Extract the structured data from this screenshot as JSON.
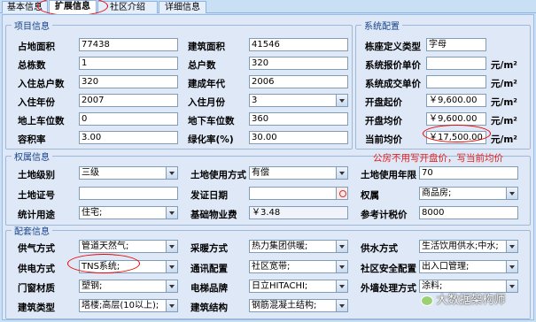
{
  "tabs": [
    "基本信息",
    "扩展信息",
    "社区介绍",
    "详细信息"
  ],
  "project": {
    "legend": "项目信息",
    "rows": [
      {
        "l1": "占地面积",
        "v1": "77438",
        "l2": "建筑面积",
        "v2": "41546"
      },
      {
        "l1": "总栋数",
        "v1": "1",
        "l2": "总户数",
        "v2": "320"
      },
      {
        "l1": "入住总户数",
        "v1": "320",
        "l2": "建成年代",
        "v2": "2006"
      },
      {
        "l1": "入住年份",
        "v1": "2007",
        "l2": "入住月份",
        "v2": "3"
      },
      {
        "l1": "地上车位数",
        "v1": "0",
        "l2": "地下车位数",
        "v2": "360"
      },
      {
        "l1": "容积率",
        "v1": "3.00",
        "l2": "绿化率(%)",
        "v2": "30.00"
      }
    ]
  },
  "system": {
    "legend": "系统配置",
    "rows": [
      {
        "label": "栋座定义类型",
        "value": "字母",
        "unit": ""
      },
      {
        "label": "系统报价单价",
        "value": "",
        "unit": "元/m²"
      },
      {
        "label": "系统成交单价",
        "value": "",
        "unit": "元/m²"
      },
      {
        "label": "开盘起价",
        "value": "￥9,600.00",
        "unit": "元/m²"
      },
      {
        "label": "开盘均价",
        "value": "￥9,600.00",
        "unit": "元/m²"
      },
      {
        "label": "当前均价",
        "value": "￥17,500.00",
        "unit": "元/m²"
      }
    ]
  },
  "note": "公房不用写开盘价，写当前均价",
  "rights": {
    "legend": "权属信息",
    "land_level_label": "土地级别",
    "land_level": "三级",
    "land_usage_label": "土地使用方式",
    "land_usage": "有偿",
    "land_years_label": "土地使用年限",
    "land_years": "70",
    "land_cert_label": "土地证号",
    "land_cert": "",
    "issue_date_label": "发证日期",
    "issue_date": "",
    "ownership_label": "权属",
    "ownership": "商品房;",
    "stat_usage_label": "统计用途",
    "stat_usage": "住宅;",
    "property_fee_label": "基础物业费",
    "property_fee": "￥3.48",
    "ref_price_label": "参考计税价",
    "ref_price": "8000"
  },
  "facilities": {
    "legend": "配套信息",
    "rows": [
      [
        {
          "label": "供气方式",
          "value": "管道天然气;"
        },
        {
          "label": "采暖方式",
          "value": "热力集团供暖;"
        },
        {
          "label": "供水方式",
          "value": "生活饮用供水;中水;"
        }
      ],
      [
        {
          "label": "供电方式",
          "value": "TNS系统;"
        },
        {
          "label": "通讯配置",
          "value": "社区宽带;"
        },
        {
          "label": "社区安全配置",
          "value": "出入口管理;"
        }
      ],
      [
        {
          "label": "门窗材质",
          "value": "塑钢;"
        },
        {
          "label": "电梯品牌",
          "value": "日立HITACHI;"
        },
        {
          "label": "外墙处理方式",
          "value": "涂料;"
        }
      ],
      [
        {
          "label": "建筑类型",
          "value": "塔楼;高层(10以上);"
        },
        {
          "label": "建筑结构",
          "value": "钢筋混凝土结构;"
        },
        {
          "label": "",
          "value": ""
        }
      ]
    ]
  },
  "watermark": "大数据架构师"
}
